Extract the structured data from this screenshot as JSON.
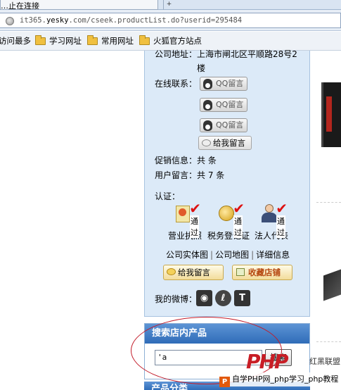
{
  "browser": {
    "tab_title": "…止在连接",
    "url_prefix": "it365.",
    "url_domain": "yesky",
    "url_rest": ".com/cseek.productList.do?userid=295484",
    "bookmarks": [
      "访问最多",
      "学习网址",
      "常用网址",
      "火狐官方站点"
    ]
  },
  "shop_info": {
    "address_line1": "公司地址：上海市闸北区平顺路28号2",
    "address_line2": "楼",
    "online_contact_label": "在线联系：",
    "qq_button_label": "QQ留言",
    "leave_message_label": "给我留言",
    "promo_label": "促销信息：共 条",
    "user_messages_label": "用户留言：共 7 条",
    "cert_label": "认证：",
    "cert_passed": "通过",
    "certs": [
      "营业执照",
      "税务登记证",
      "法人代表"
    ],
    "links": [
      "公司实体图",
      "公司地图",
      "详细信息"
    ],
    "bottom_message_button": "给我留言",
    "favorite_button": "收藏店铺",
    "weibo_label": "我的微博："
  },
  "search": {
    "title": "搜索店内产品",
    "input_value": "'a",
    "button_label": "搜索"
  },
  "category": {
    "title": "产品分类"
  },
  "watermark": {
    "logo": "PHP",
    "side_text": "红黑联盟",
    "band_text": "自学PHP网_php学习_php教程"
  },
  "colors": {
    "panel_bg": "#dceaf8",
    "header_blue": "#3a77c2",
    "annotation_red": "#c21c2a"
  }
}
